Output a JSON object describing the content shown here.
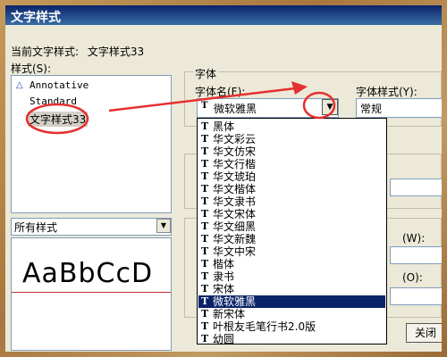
{
  "window": {
    "title": "文字样式"
  },
  "current_style": {
    "label": "当前文字样式:",
    "value": "文字样式33"
  },
  "styles": {
    "label": "样式(S):",
    "items": [
      "Annotative",
      "Standard",
      "文字样式33"
    ]
  },
  "filter": {
    "value": "所有样式"
  },
  "preview": {
    "text": "AaBbCcD"
  },
  "font_group": {
    "title": "字体",
    "font_name_label": "字体名(F):",
    "font_name_value": "微软雅黑",
    "font_style_label": "字体样式(Y):",
    "font_style_value": "常规"
  },
  "side_labels": {
    "width_suffix": "(W):",
    "oblique_suffix": "(O):"
  },
  "font_dropdown": {
    "options": [
      "黑体",
      "华文彩云",
      "华文仿宋",
      "华文行楷",
      "华文琥珀",
      "华文楷体",
      "华文隶书",
      "华文宋体",
      "华文细黑",
      "华文新魏",
      "华文中宋",
      "楷体",
      "隶书",
      "宋体",
      "微软雅黑",
      "新宋体",
      "叶根友毛笔行书2.0版",
      "幼圆"
    ],
    "selected": "微软雅黑"
  },
  "buttons": {
    "apply": "关闭"
  },
  "colors": {
    "annotation": "#e53030",
    "selection": "#0a246a"
  },
  "icons": {
    "truetype": "truetype-icon",
    "annotative": "annotative-icon"
  }
}
